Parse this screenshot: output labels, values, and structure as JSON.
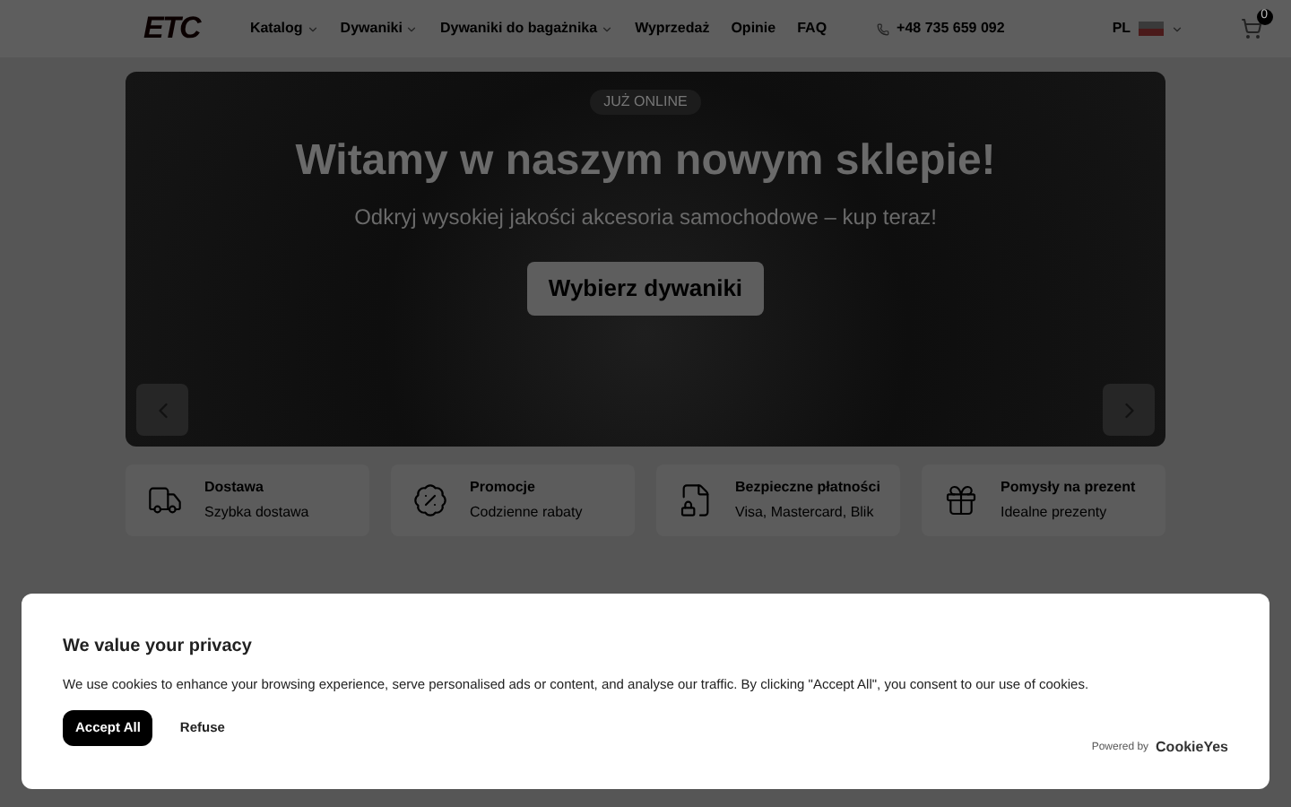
{
  "header": {
    "logo": "ETC",
    "nav": [
      {
        "label": "Katalog",
        "dropdown": true
      },
      {
        "label": "Dywaniki",
        "dropdown": true
      },
      {
        "label": "Dywaniki do bagażnika",
        "dropdown": true
      },
      {
        "label": "Wyprzedaż",
        "dropdown": false
      },
      {
        "label": "Opinie",
        "dropdown": false
      },
      {
        "label": "FAQ",
        "dropdown": false
      }
    ],
    "phone": "+48 735 659 092",
    "language": "PL",
    "cart_count": "0"
  },
  "hero": {
    "badge": "JUŻ ONLINE",
    "title": "Witamy w naszym nowym sklepie!",
    "subtitle": "Odkryj wysokiej jakości akcesoria samochodowe – kup teraz!",
    "button": "Wybierz dywaniki"
  },
  "features": [
    {
      "title": "Dostawa",
      "text": "Szybka dostawa"
    },
    {
      "title": "Promocje",
      "text": "Codzienne rabaty"
    },
    {
      "title": "Bezpieczne płatności",
      "text": "Visa, Mastercard, Blik"
    },
    {
      "title": "Pomysły na prezent",
      "text": "Idealne prezenty"
    }
  ],
  "cookie_banner": {
    "title": "We value your privacy",
    "text": "We use cookies to enhance your browsing experience, serve personalised ads or content, and analyse our traffic. By clicking \"Accept All\", you consent to our use of cookies.",
    "buttons": [
      {
        "label": "Accept All",
        "kind": "primary"
      },
      {
        "label": "Refuse",
        "kind": "plain"
      }
    ],
    "powered_by": "Powered by",
    "brand": "CookieYes"
  }
}
